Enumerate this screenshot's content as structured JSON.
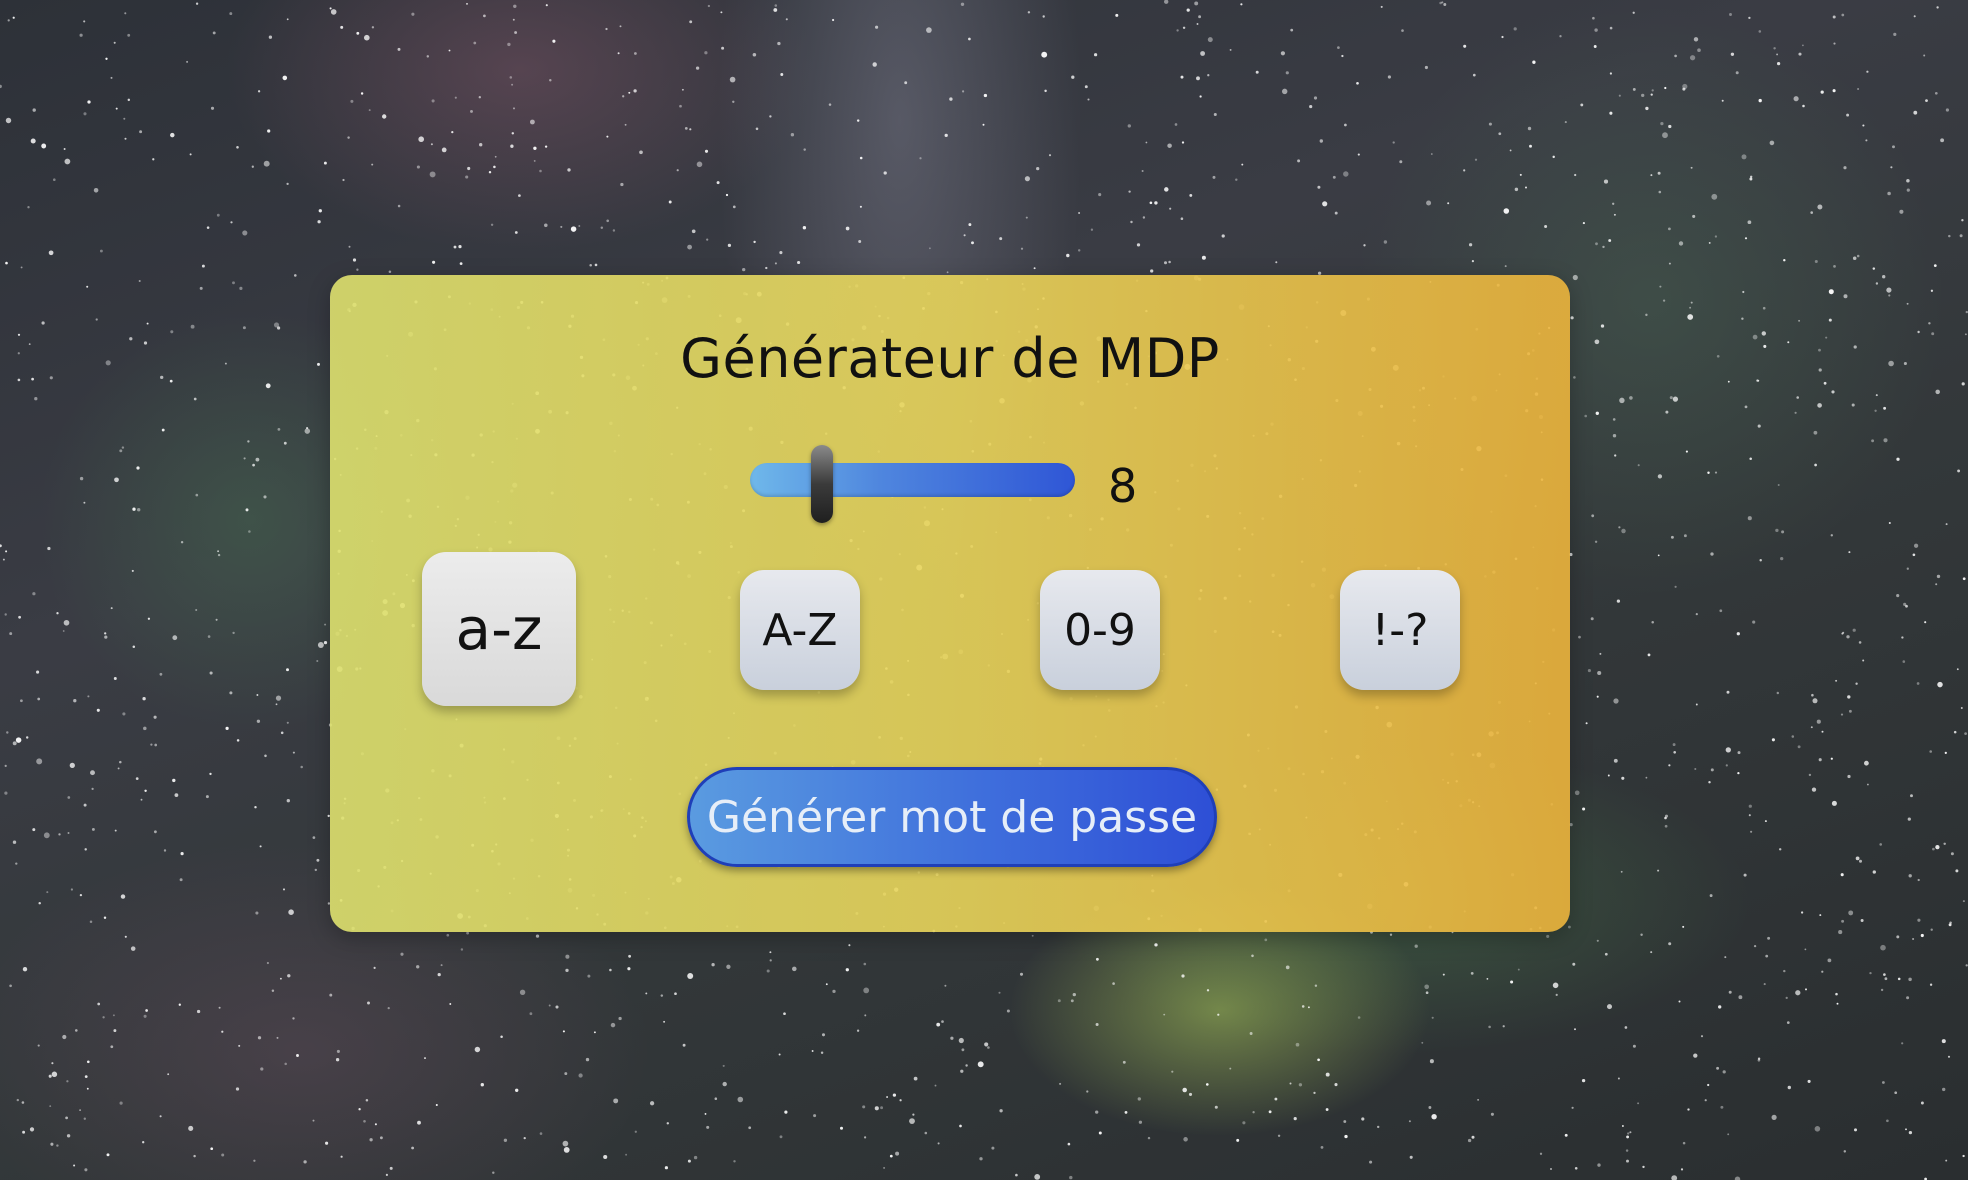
{
  "app": {
    "title": "Générateur de MDP"
  },
  "length_slider": {
    "value": "8",
    "fill_fraction": 0.2
  },
  "charsets": [
    {
      "label": "a-z",
      "active": true
    },
    {
      "label": "A-Z",
      "active": false
    },
    {
      "label": "0-9",
      "active": false
    },
    {
      "label": "!-?",
      "active": false
    }
  ],
  "generate_button": {
    "label": "Générer mot de passe"
  },
  "colors": {
    "card_left": "#dee16e",
    "card_right": "#ecb43c",
    "slider_start": "#6fb8ea",
    "slider_end": "#2f56d6",
    "button_blue": "#3f6fdc"
  }
}
